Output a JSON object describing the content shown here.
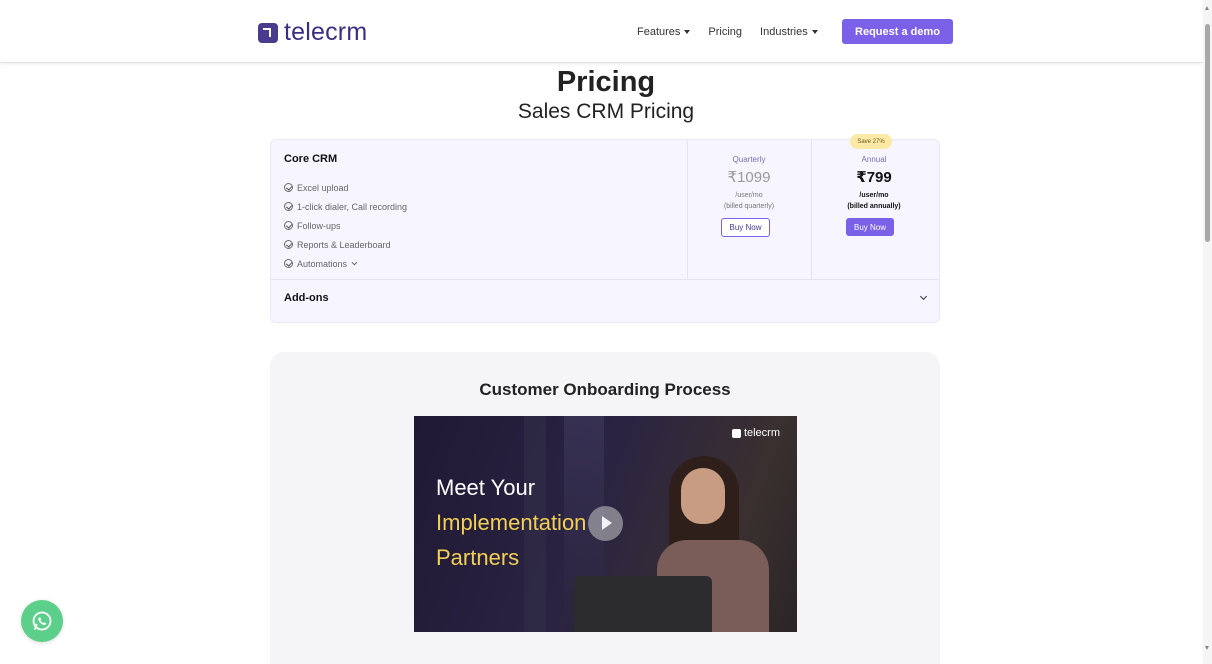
{
  "header": {
    "logo_text": "telecrm",
    "nav": [
      {
        "label": "Features",
        "has_dropdown": true
      },
      {
        "label": "Pricing",
        "has_dropdown": false
      },
      {
        "label": "Industries",
        "has_dropdown": true
      }
    ],
    "cta_label": "Request a demo",
    "accent_color": "#7b61e8",
    "brand_color": "#3c2f82"
  },
  "page": {
    "title": "Pricing",
    "subtitle": "Sales CRM Pricing"
  },
  "plan": {
    "name": "Core CRM",
    "features": [
      "Excel upload",
      "1-click dialer, Call recording",
      "Follow-ups",
      "Reports & Leaderboard",
      "Automations"
    ],
    "quarterly": {
      "period": "Quarterly",
      "price": "₹1099",
      "unit": "/user/mo",
      "billing": "(billed quarterly)",
      "button": "Buy Now"
    },
    "annual": {
      "badge": "Save 27%",
      "period": "Annual",
      "price": "₹799",
      "unit": "/user/mo",
      "billing": "(billed annually)",
      "button": "Buy Now"
    },
    "addons_label": "Add-ons"
  },
  "onboarding": {
    "title": "Customer Onboarding Process",
    "video": {
      "logo_text": "telecrm",
      "line1": "Meet Your",
      "line2": "Implementation",
      "line3": "Partners"
    }
  },
  "icons": {
    "whatsapp": "whatsapp-icon",
    "check": "check-circle-icon",
    "chevron": "chevron-down-icon",
    "play": "play-icon"
  }
}
